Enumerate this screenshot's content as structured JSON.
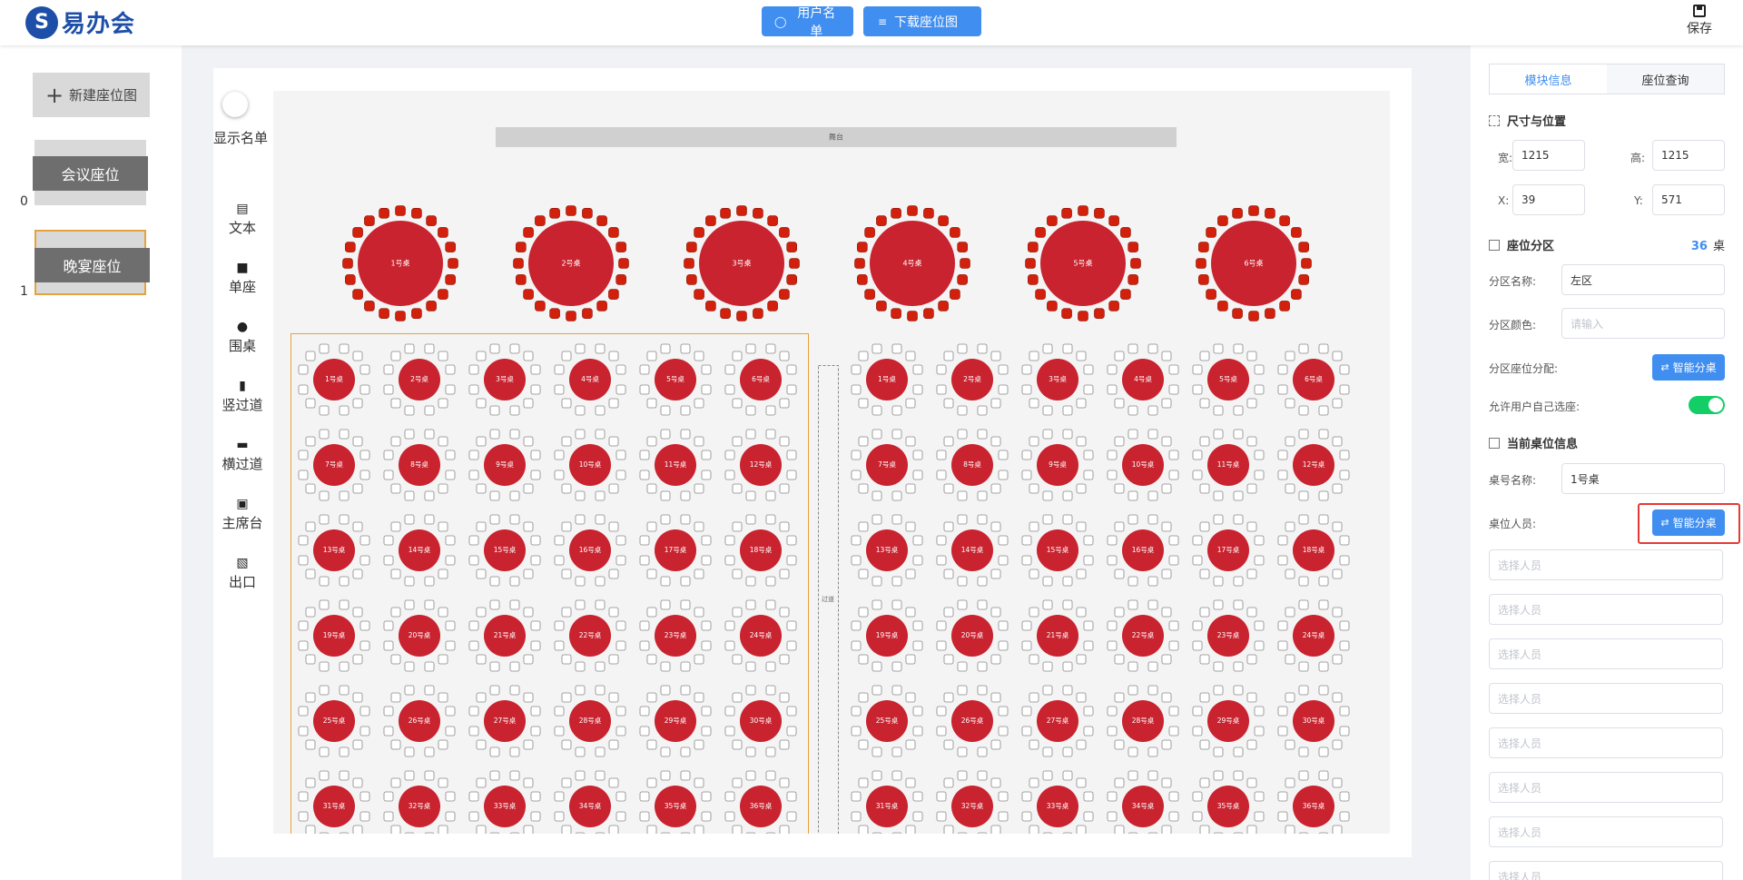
{
  "topbar": {
    "logo_text": "易办会",
    "logo_mark": "S",
    "users_button": "用户名单",
    "download_button": "下载座位图",
    "save_label": "保存"
  },
  "left": {
    "new_plan": "新建座位图",
    "plans": [
      {
        "name": "会议座位",
        "index": "0"
      },
      {
        "name": "晚宴座位",
        "index": "1"
      }
    ]
  },
  "toolbar": {
    "show_list": "显示名单",
    "tools": [
      "文本",
      "单座",
      "围桌",
      "竖过道",
      "横过道",
      "主席台",
      "出口"
    ]
  },
  "stage": {
    "label": "舞台",
    "aisle_label": "过道"
  },
  "top_tables": [
    "1号桌",
    "2号桌",
    "3号桌",
    "4号桌",
    "5号桌",
    "6号桌"
  ],
  "zone_tables": [
    "1号桌",
    "2号桌",
    "3号桌",
    "4号桌",
    "5号桌",
    "6号桌",
    "7号桌",
    "8号桌",
    "9号桌",
    "10号桌",
    "11号桌",
    "12号桌",
    "13号桌",
    "14号桌",
    "15号桌",
    "16号桌",
    "17号桌",
    "18号桌",
    "19号桌",
    "20号桌",
    "21号桌",
    "22号桌",
    "23号桌",
    "24号桌",
    "25号桌",
    "26号桌",
    "27号桌",
    "28号桌",
    "29号桌",
    "30号桌",
    "31号桌",
    "32号桌",
    "33号桌",
    "34号桌",
    "35号桌",
    "36号桌"
  ],
  "colors": {
    "accent": "#3f8ef0",
    "table_red": "#c8232f",
    "seat_red": "#d2200c",
    "zone_border": "#e6a23c",
    "switch_on": "#13ce66"
  },
  "right": {
    "tabs": [
      "模块信息",
      "座位查询"
    ],
    "size_section": "尺寸与位置",
    "width_label": "宽:",
    "width_value": "1215",
    "height_label": "高:",
    "height_value": "1215",
    "x_label": "X:",
    "x_value": "39",
    "y_label": "Y:",
    "y_value": "571",
    "zone_section": "座位分区",
    "zone_count": "36",
    "zone_count_unit": "桌",
    "zone_name_label": "分区名称:",
    "zone_name_value": "左区",
    "zone_color_label": "分区颜色:",
    "zone_color_placeholder": "请输入",
    "zone_assign_label": "分区座位分配:",
    "smart_button": "智能分桌",
    "allow_self_label": "允许用户自己选座:",
    "table_section": "当前桌位信息",
    "table_name_label": "桌号名称:",
    "table_name_value": "1号桌",
    "table_people_label": "桌位人员:",
    "person_placeholder": "选择人员"
  }
}
